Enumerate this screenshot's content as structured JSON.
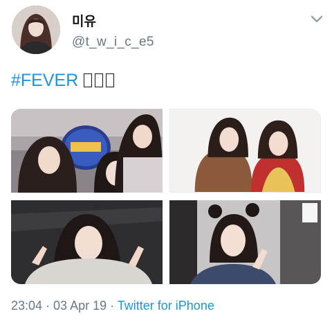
{
  "user": {
    "display_name": "미유",
    "handle": "@t_w_i_c_e5"
  },
  "tweet": {
    "hashtag": "#FEVER",
    "trailing_glyphs": [
      "□",
      "□",
      "□"
    ]
  },
  "media": [
    {
      "alt": "photo-1"
    },
    {
      "alt": "photo-2"
    },
    {
      "alt": "photo-3"
    },
    {
      "alt": "photo-4"
    }
  ],
  "meta": {
    "time": "23:04",
    "separator1": " · ",
    "date": "03 Apr 19",
    "separator2": " · ",
    "source": "Twitter for iPhone"
  },
  "colors": {
    "link": "#1b95e0",
    "muted": "#657786",
    "text": "#14171a"
  }
}
